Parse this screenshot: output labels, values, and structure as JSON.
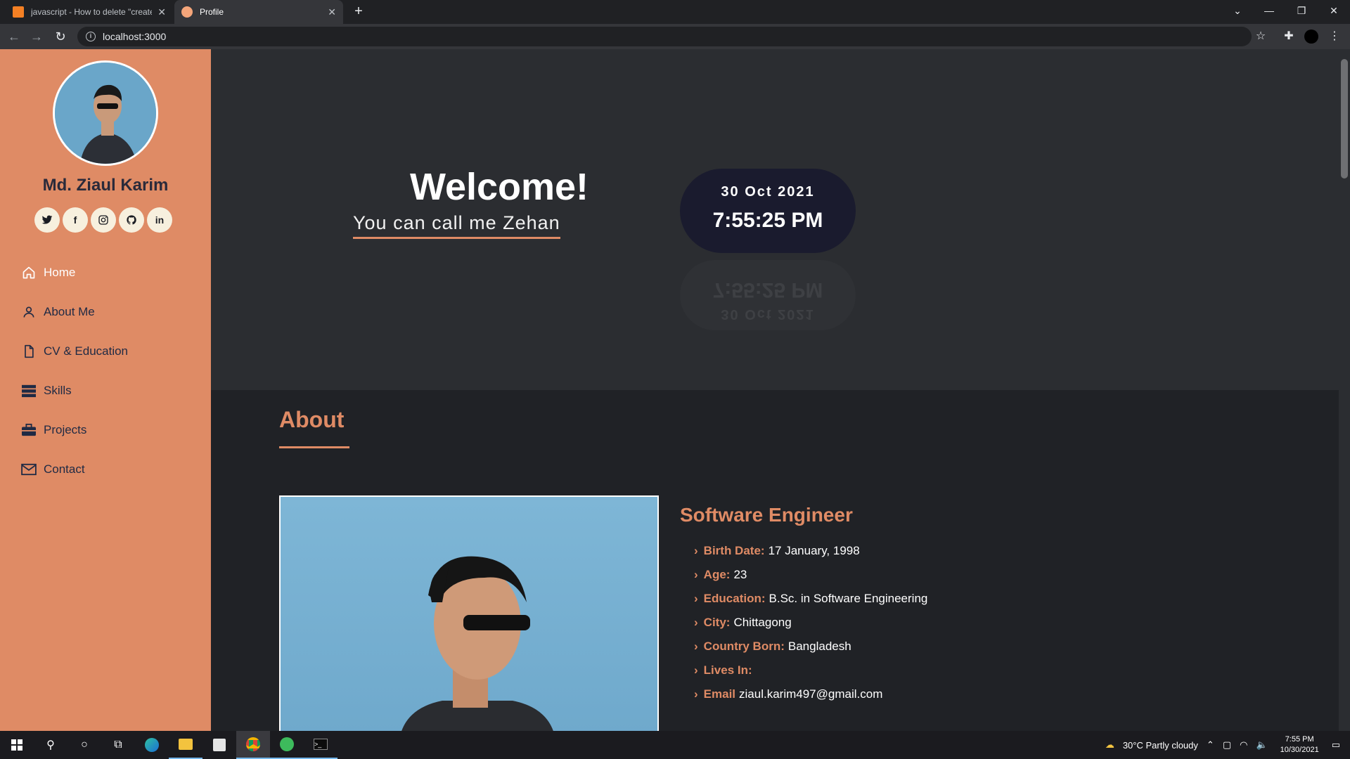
{
  "browser": {
    "tabs": [
      {
        "title": "javascript - How to delete \"create",
        "active": false
      },
      {
        "title": "Profile",
        "active": true
      }
    ],
    "url": "localhost:3000"
  },
  "sidebar": {
    "name": "Md. Ziaul Karim",
    "socials": [
      {
        "icon": "twitter-icon",
        "glyph": "🐦"
      },
      {
        "icon": "facebook-icon",
        "glyph": "f"
      },
      {
        "icon": "instagram-icon",
        "glyph": "◎"
      },
      {
        "icon": "github-icon",
        "glyph": "◉"
      },
      {
        "icon": "linkedin-icon",
        "glyph": "in"
      }
    ],
    "nav": [
      {
        "label": "Home",
        "icon": "home-icon",
        "active": true
      },
      {
        "label": "About Me",
        "icon": "user-icon",
        "active": false
      },
      {
        "label": "CV & Education",
        "icon": "file-icon",
        "active": false
      },
      {
        "label": "Skills",
        "icon": "server-icon",
        "active": false
      },
      {
        "label": "Projects",
        "icon": "briefcase-icon",
        "active": false
      },
      {
        "label": "Contact",
        "icon": "envelope-icon",
        "active": false
      }
    ]
  },
  "hero": {
    "welcome": "Welcome!",
    "callme": "You can call me Zehan",
    "date": "30 Oct 2021",
    "time": "7:55:25 PM"
  },
  "about": {
    "title": "About",
    "role": "Software Engineer",
    "facts": [
      {
        "key": "Birth Date:",
        "value": "17 January, 1998"
      },
      {
        "key": "Age:",
        "value": "23"
      },
      {
        "key": "Education:",
        "value": "B.Sc. in Software Engineering"
      },
      {
        "key": "City:",
        "value": "Chittagong"
      },
      {
        "key": "Country Born:",
        "value": "Bangladesh"
      },
      {
        "key": "Lives In:",
        "value": ""
      },
      {
        "key": "Email",
        "value": "ziaul.karim497@gmail.com"
      }
    ]
  },
  "taskbar": {
    "weather": "30°C  Partly cloudy",
    "time": "7:55 PM",
    "date": "10/30/2021"
  },
  "colors": {
    "accent": "#df8b65",
    "sidebar": "#df8b65",
    "hero_bg": "#2b2d31",
    "clock_bg": "#1a1b2e"
  }
}
